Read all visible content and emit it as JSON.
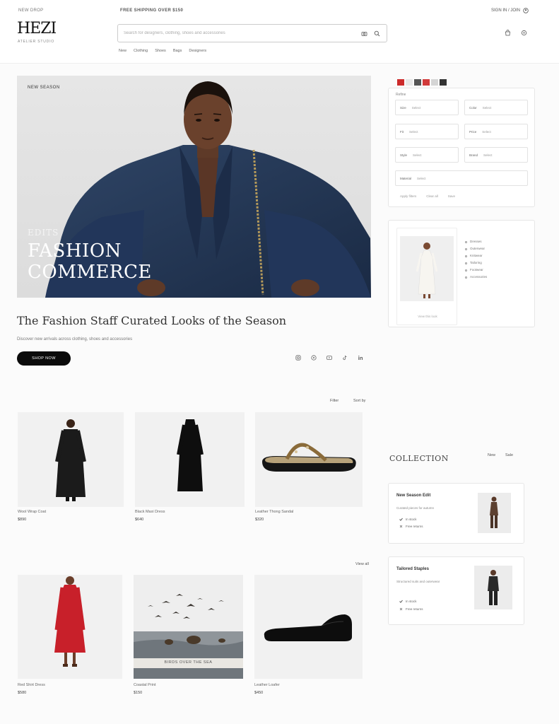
{
  "header": {
    "top_left": "NEW DROP",
    "top_center": "FREE SHIPPING OVER $150",
    "top_right": "SIGN IN / JOIN",
    "logo": "HEZI",
    "logo_sub": "ATELIER STUDIO",
    "search_placeholder": "Search for designers, clothing, shoes and accessories",
    "nav": [
      "New",
      "Clothing",
      "Shoes",
      "Bags",
      "Designers"
    ]
  },
  "hero": {
    "tag": "NEW SEASON",
    "overline": "EDITS",
    "title_line1": "FASHION",
    "title_line2": "COMMERCE",
    "headline": "The Fashion Staff Curated Looks of the Season",
    "subline": "Discover new arrivals across clothing, shoes and accessories",
    "cta": "SHOP NOW"
  },
  "filters": {
    "label": "Refine",
    "fields": [
      {
        "k": "Size",
        "v": "Select"
      },
      {
        "k": "Color",
        "v": "Select"
      },
      {
        "k": "Fit",
        "v": "Select"
      },
      {
        "k": "Price",
        "v": "Select"
      },
      {
        "k": "Style",
        "v": "Select"
      },
      {
        "k": "Brand",
        "v": "Select"
      },
      {
        "k": "Material",
        "v": "Select"
      }
    ],
    "foot": [
      "Apply filters",
      "Clear all",
      "Save"
    ],
    "swatches": [
      "#cc2b2b",
      "#e8e8e8",
      "#555555",
      "#d13a3a",
      "#d5d5d5",
      "#333333"
    ]
  },
  "featured": {
    "caption": "View this look",
    "options": [
      "Dresses",
      "Outerwear",
      "Knitwear",
      "Tailoring",
      "Footwear",
      "Accessories"
    ]
  },
  "grid1": {
    "links": [
      "Filter",
      "Sort by"
    ],
    "items": [
      {
        "name": "Wool Wrap Coat",
        "price": "$890"
      },
      {
        "name": "Black Maxi Dress",
        "price": "$640"
      },
      {
        "name": "Leather Thong Sandal",
        "price": "$320"
      }
    ]
  },
  "grid2": {
    "link": "View all",
    "items": [
      {
        "name": "Red Shirt Dress",
        "price": "$580"
      },
      {
        "name": "Coastal Print",
        "price": "$150",
        "caption": "BIRDS OVER THE SEA"
      },
      {
        "name": "Leather Loafer",
        "price": "$450"
      }
    ]
  },
  "collection": {
    "title": "COLLECTION",
    "links": [
      "New",
      "Sale"
    ],
    "cards": [
      {
        "title": "New Season Edit",
        "sub": "Curated pieces for autumn",
        "rows": [
          "In stock",
          "Free returns"
        ]
      },
      {
        "title": "Tailored Staples",
        "sub": "Structured suits and outerwear",
        "rows": [
          "In stock",
          "Free returns"
        ]
      }
    ]
  },
  "colors": {
    "accent": "#0b0b0b",
    "jacket": "#243854",
    "dress_red": "#c8202a"
  }
}
